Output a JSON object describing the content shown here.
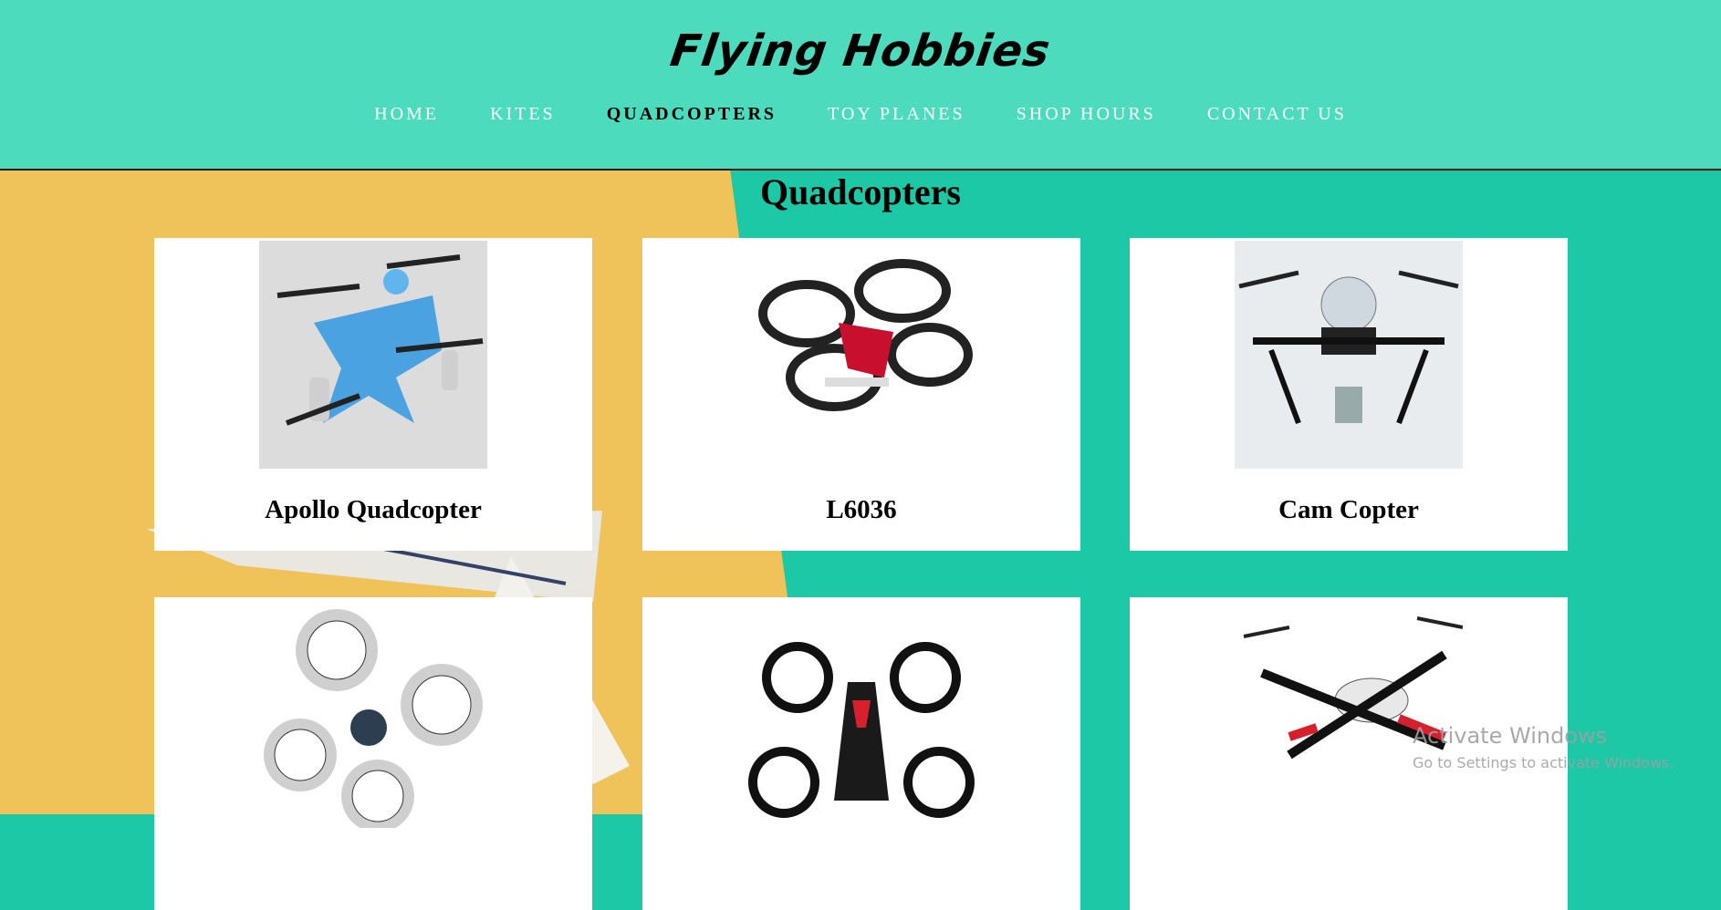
{
  "site": {
    "logo": "Flying Hobbies",
    "nav": [
      {
        "label": "HOME"
      },
      {
        "label": "KITES"
      },
      {
        "label": "QUADCOPTERS"
      },
      {
        "label": "TOY PLANES"
      },
      {
        "label": "SHOP HOURS"
      },
      {
        "label": "CONTACT US"
      }
    ],
    "active_nav": "QUADCOPTERS"
  },
  "main": {
    "title": "Quadcopters",
    "products": [
      {
        "name": "Apollo Quadcopter",
        "image": "blue-quadcopter-image"
      },
      {
        "name": "L6036",
        "image": "black-ring-quadcopter-image"
      },
      {
        "name": "Cam Copter",
        "image": "camera-quadcopter-image"
      },
      {
        "name": "",
        "image": "white-ducted-quadcopter-image"
      },
      {
        "name": "",
        "image": "black-red-quadcopter-image"
      },
      {
        "name": "",
        "image": "white-red-quadcopter-image"
      }
    ]
  },
  "os_overlay": {
    "line1": "Activate Windows",
    "line2": "Go to Settings to activate Windows."
  },
  "colors": {
    "header": "#4cdcbd",
    "bg_left": "#f0c45a",
    "bg_right": "#1cc8a6",
    "nav_text": "#ffffff",
    "nav_active": "#000000"
  }
}
